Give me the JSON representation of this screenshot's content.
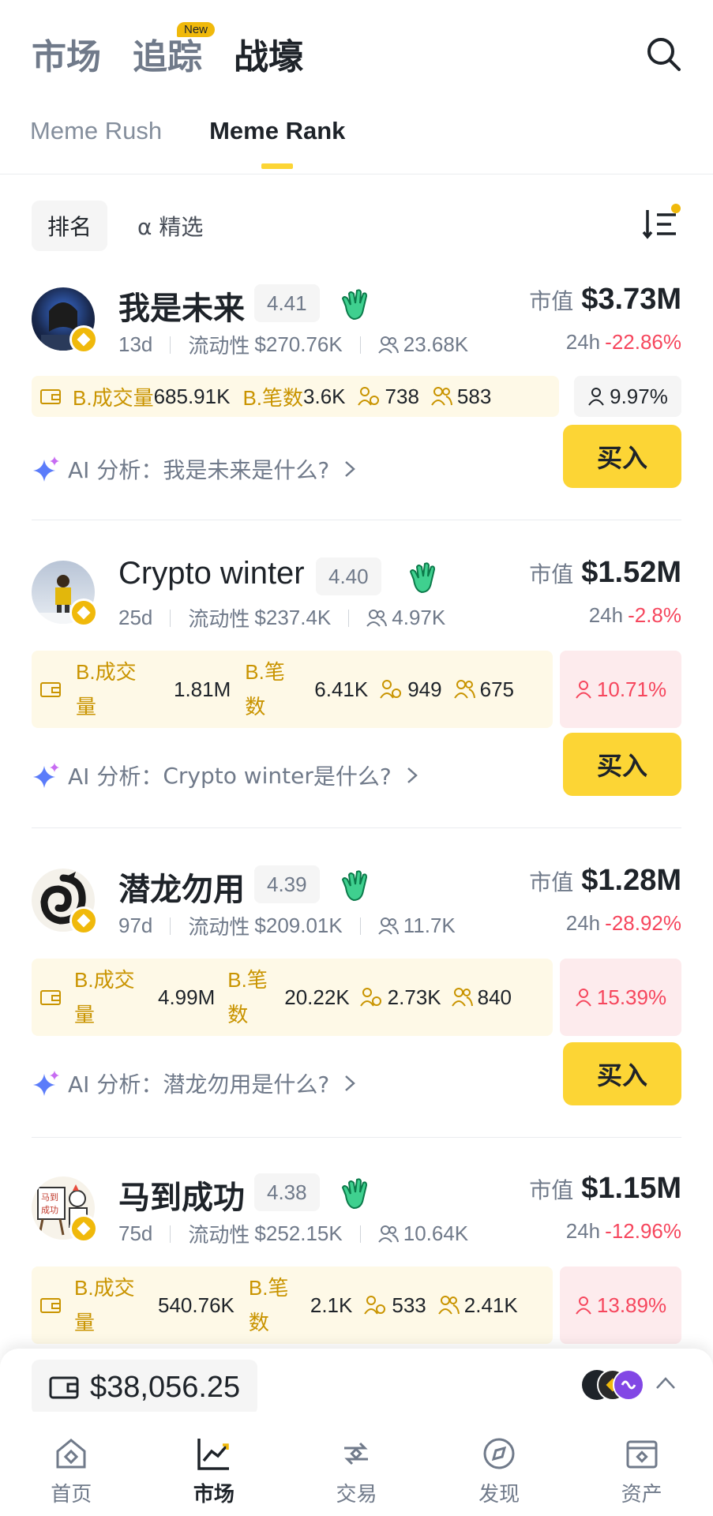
{
  "header": {
    "tabs": [
      {
        "label": "市场"
      },
      {
        "label": "追踪",
        "badge": "New"
      },
      {
        "label": "战壕"
      }
    ],
    "search_icon": "search-icon"
  },
  "sub_tabs": [
    "Meme Rush",
    "Meme Rank"
  ],
  "filters": {
    "rank": "排名",
    "alpha": "α 精选"
  },
  "labels": {
    "mcap": "市值",
    "liquidity": "流动性",
    "h24": "24h",
    "ai_prefix": "AI 分析：",
    "ai_suffix": " 是什么?",
    "buy": "买入",
    "b_volume": "B.成交量",
    "b_trades": "B.笔数"
  },
  "tokens": [
    {
      "name": "我是未来",
      "score": "4.41",
      "mcap": "$3.73M",
      "age": "13d",
      "liquidity": "$270.76K",
      "holders": "23.68K",
      "change": "-22.86%",
      "volume": "685.91K",
      "trades": "3.6K",
      "smart": "738",
      "kol": "583",
      "top_pct": "9.97%"
    },
    {
      "name": "Crypto winter",
      "score": "4.40",
      "mcap": "$1.52M",
      "age": "25d",
      "liquidity": "$237.4K",
      "holders": "4.97K",
      "change": "-2.8%",
      "volume": "1.81M",
      "trades": "6.41K",
      "smart": "949",
      "kol": "675",
      "top_pct": "10.71%"
    },
    {
      "name": "潜龙勿用",
      "score": "4.39",
      "mcap": "$1.28M",
      "age": "97d",
      "liquidity": "$209.01K",
      "holders": "11.7K",
      "change": "-28.92%",
      "volume": "4.99M",
      "trades": "20.22K",
      "smart": "2.73K",
      "kol": "840",
      "top_pct": "15.39%"
    },
    {
      "name": "马到成功",
      "score": "4.38",
      "mcap": "$1.15M",
      "age": "75d",
      "liquidity": "$252.15K",
      "holders": "10.64K",
      "change": "-12.96%",
      "volume": "540.76K",
      "trades": "2.1K",
      "smart": "533",
      "kol": "2.41K",
      "top_pct": "13.89%"
    }
  ],
  "wallet": {
    "balance": "$38,056.25"
  },
  "bottom_nav": [
    "首页",
    "市场",
    "交易",
    "发现",
    "资产"
  ],
  "colors": {
    "accent": "#fcd535",
    "negative": "#f6465d",
    "gold_text": "#c99400"
  }
}
